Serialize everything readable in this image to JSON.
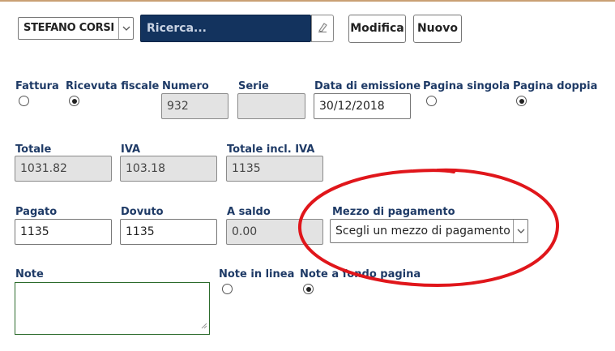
{
  "header": {
    "user_select": "STEFANO CORSI",
    "search_placeholder": "Ricerca...",
    "edit_label": "Modifica",
    "new_label": "Nuovo"
  },
  "doc_type": {
    "fattura_label": "Fattura",
    "ricevuta_label": "Ricevuta fiscale",
    "selected": "Ricevuta fiscale"
  },
  "numero": {
    "label": "Numero",
    "value": "932"
  },
  "serie": {
    "label": "Serie",
    "value": ""
  },
  "data_emissione": {
    "label": "Data di emissione",
    "value": "30/12/2018"
  },
  "page_layout": {
    "single_label": "Pagina singola",
    "double_label": "Pagina doppia",
    "selected": "Pagina doppia"
  },
  "totale": {
    "label": "Totale",
    "value": "1031.82"
  },
  "iva": {
    "label": "IVA",
    "value": "103.18"
  },
  "totale_iva": {
    "label": "Totale incl. IVA",
    "value": "1135"
  },
  "pagato": {
    "label": "Pagato",
    "value": "1135"
  },
  "dovuto": {
    "label": "Dovuto",
    "value": "1135"
  },
  "a_saldo": {
    "label": "A saldo",
    "value": "0.00"
  },
  "mezzo_pagamento": {
    "label": "Mezzo di pagamento",
    "value": "Scegli un mezzo di pagamento"
  },
  "note": {
    "label": "Note",
    "value": ""
  },
  "note_position": {
    "inline_label": "Note in linea",
    "footer_label": "Note a fondo pagina",
    "selected": "Note a fondo pagina"
  },
  "annotation": {
    "color": "#e0161b"
  }
}
